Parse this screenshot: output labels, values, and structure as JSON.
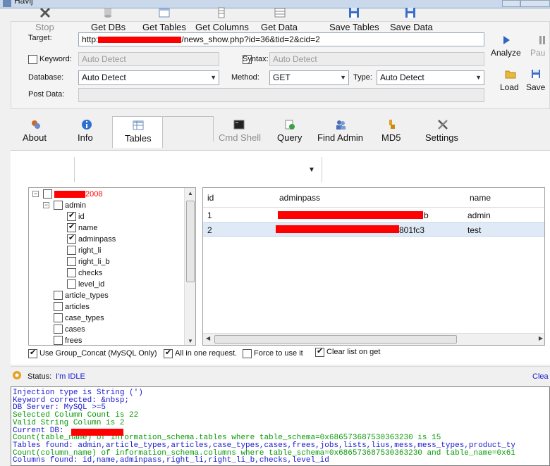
{
  "window": {
    "title": "Havij"
  },
  "target": {
    "label": "Target:",
    "url_prefix": "http:",
    "url_suffix": "/news_show.php?id=36&tid=2&cid=2"
  },
  "keyword": {
    "label": "Keyword:",
    "checked": false,
    "placeholder": "Auto Detect"
  },
  "syntax": {
    "label": "Syntax:",
    "checked": false,
    "placeholder": "Auto Detect"
  },
  "database": {
    "label": "Database:",
    "value": "Auto Detect"
  },
  "method": {
    "label": "Method:",
    "value": "GET"
  },
  "type": {
    "label": "Type:",
    "value": "Auto Detect"
  },
  "postdata": {
    "label": "Post Data:",
    "value": ""
  },
  "side_buttons": {
    "analyze": "Analyze",
    "pause": "Pau",
    "load": "Load",
    "save": "Save"
  },
  "tabs": [
    {
      "label": "About",
      "icon": "about-icon"
    },
    {
      "label": "Info",
      "icon": "info-icon"
    },
    {
      "label": "Tables",
      "icon": "tables-icon",
      "selected": true
    },
    {
      "label": "Cmd Shell",
      "icon": "cmd-shell-icon",
      "disabled": true
    },
    {
      "label": "Query",
      "icon": "query-icon"
    },
    {
      "label": "Find Admin",
      "icon": "find-admin-icon"
    },
    {
      "label": "MD5",
      "icon": "md5-icon"
    },
    {
      "label": "Settings",
      "icon": "settings-icon"
    }
  ],
  "toolbar": {
    "stop": "Stop",
    "get_dbs": "Get DBs",
    "get_tables": "Get Tables",
    "get_columns": "Get Columns",
    "get_data": "Get Data",
    "save_tables": "Save Tables",
    "save_data": "Save Data"
  },
  "tree": {
    "db_name_visible": "2008",
    "admin_table": "admin",
    "columns": [
      {
        "name": "id",
        "checked": true
      },
      {
        "name": "name",
        "checked": true
      },
      {
        "name": "adminpass",
        "checked": true
      },
      {
        "name": "right_li",
        "checked": false
      },
      {
        "name": "right_li_b",
        "checked": false
      },
      {
        "name": "checks",
        "checked": false
      },
      {
        "name": "level_id",
        "checked": false
      }
    ],
    "tables": [
      "article_types",
      "articles",
      "case_types",
      "cases",
      "frees"
    ]
  },
  "grid": {
    "headers": [
      "id",
      "adminpass",
      "name"
    ],
    "rows": [
      {
        "id": "1",
        "adminpass_visible": "b",
        "name": "admin"
      },
      {
        "id": "2",
        "adminpass_visible": "801fc3",
        "name": "test"
      }
    ]
  },
  "options": {
    "group_concat": {
      "label": "Use Group_Concat (MySQL Only)",
      "checked": true
    },
    "all_in_one": {
      "label": "All in one request.",
      "checked": true
    },
    "force": {
      "label": "Force to use it",
      "checked": false
    },
    "clear_list": {
      "label": "Clear list on get",
      "checked": true
    }
  },
  "status": {
    "label": "Status:",
    "value": "I'm IDLE",
    "clear": "Clea"
  },
  "console": {
    "lines": [
      {
        "text": "Injection type is String (')",
        "color": "blue"
      },
      {
        "text": "Keyword corrected: &nbsp;",
        "color": "blue"
      },
      {
        "text": "DB Server: MySQL >=5",
        "color": "blue"
      },
      {
        "text": "Selected Column Count is 22",
        "color": "green"
      },
      {
        "text": "Valid String Column is 2",
        "color": "green"
      },
      {
        "text": "Current DB: ",
        "color": "blue"
      },
      {
        "text": "Count(table_name) of information_schema.tables where table_schema=0x686573687530363230 is 15",
        "color": "green"
      },
      {
        "text": "Tables found: admin,article_types,articles,case_types,cases,frees,jobs,lists,lius,mess,mess_types,product_ty",
        "color": "blue"
      },
      {
        "text": "Count(column_name) of information_schema.columns where table_schema=0x686573687530363230 and table_name=0x61",
        "color": "green"
      },
      {
        "text": "Columns found: id,name,adminpass,right_li,right_li_b,checks,level_id",
        "color": "blue"
      }
    ]
  },
  "colors": {
    "redaction": "#ff0000",
    "console_blue": "#1a1ad0",
    "console_green": "#0a9a0a",
    "status_blue": "#1a1ad0"
  }
}
